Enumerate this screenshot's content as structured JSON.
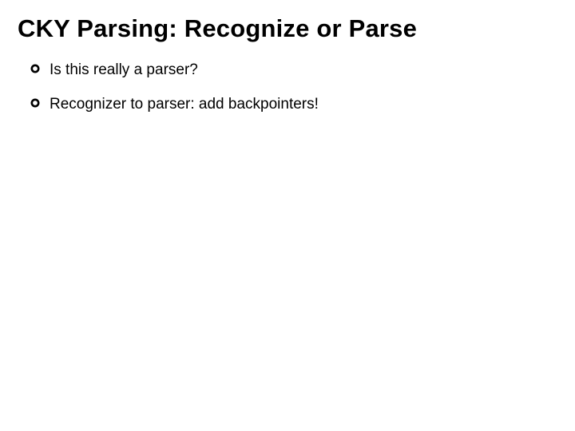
{
  "slide": {
    "title": "CKY Parsing: Recognize or Parse",
    "bullets": [
      {
        "text": "Is this really a parser?"
      },
      {
        "text": "Recognizer to parser: add backpointers!"
      }
    ]
  }
}
